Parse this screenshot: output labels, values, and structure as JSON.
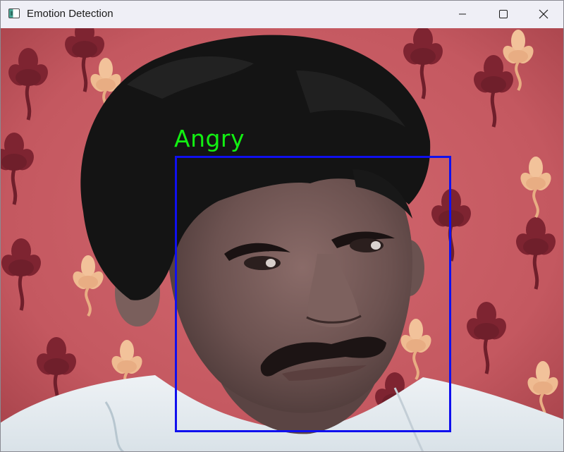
{
  "window": {
    "title": "Emotion Detection",
    "controls": {
      "minimize_icon": "minimize-icon",
      "maximize_icon": "maximize-icon",
      "close_icon": "close-icon"
    }
  },
  "detection": {
    "label": "Angry",
    "box_color": "#1010ee",
    "label_color": "#12f012"
  },
  "colors": {
    "background_fabric": "#c75a63",
    "flower_dark": "#7e2431",
    "flower_light": "#f2c29a",
    "hair": "#141414",
    "skin": "#6e5553",
    "shirt": "#e8eef2"
  }
}
